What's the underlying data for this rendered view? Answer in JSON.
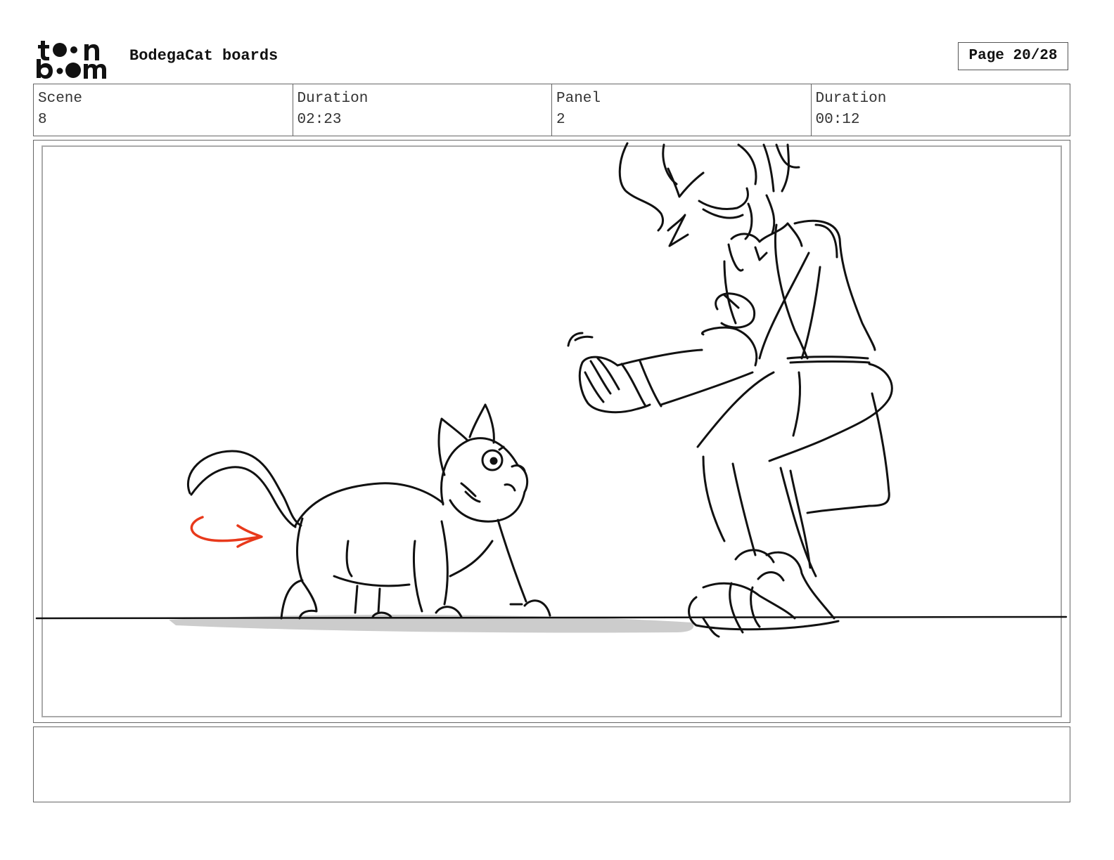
{
  "header": {
    "logo_line1": "toon",
    "logo_line2": "boom",
    "title": "BodegaCat boards",
    "page_label": "Page 20/28"
  },
  "info": [
    {
      "label": "Scene",
      "value": "8"
    },
    {
      "label": "Duration",
      "value": "02:23"
    },
    {
      "label": "Panel",
      "value": "2"
    },
    {
      "label": "Duration",
      "value": "00:12"
    }
  ],
  "notes": {
    "text": ""
  },
  "colors": {
    "ink": "#111111",
    "frame": "#666666",
    "action_arrow": "#e8391b",
    "shadow": "#cccccc"
  }
}
